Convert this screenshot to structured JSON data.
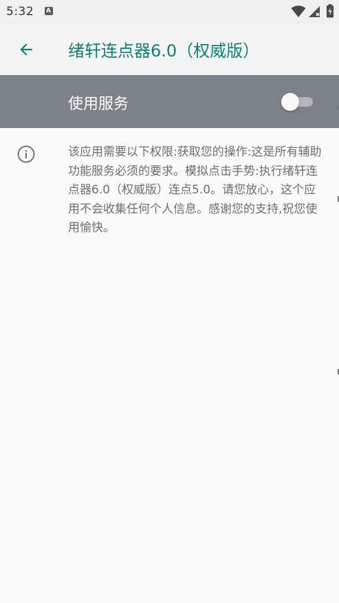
{
  "status_bar": {
    "time": "5:32",
    "notification_icon": "a-icon",
    "wifi_icon": "wifi-icon",
    "signal_icon": "signal-icon",
    "battery_icon": "battery-icon"
  },
  "toolbar": {
    "back_icon": "arrow-left-icon",
    "title": "绪轩连点器6.0（权威版）",
    "title_color": "#0f7f74"
  },
  "service": {
    "label": "使用服务",
    "enabled": false,
    "bar_color": "#7d8288"
  },
  "info": {
    "icon": "info-icon",
    "text": "该应用需要以下权限:获取您的操作:这是所有辅助功能服务必须的要求。模拟点击手势:执行绪轩连点器6.0（权威版）连点5.0。请您放心，这个应用不会收集任何个人信息。感谢您的支持,祝您使用愉快。"
  }
}
